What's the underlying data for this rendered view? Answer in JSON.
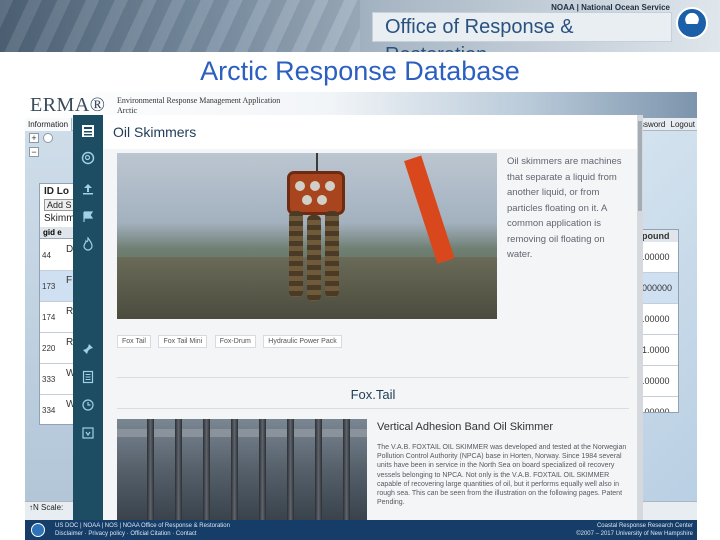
{
  "banner": {
    "noaa_line": "NOAA | National Ocean Service",
    "org_name": "Office of Response & Restoration",
    "logo_icon": "noaa-logo"
  },
  "slide_title": "Arctic Response Database",
  "erma": {
    "logo": "ERMA®",
    "subtitle_line1": "Environmental Response Management Application",
    "subtitle_line2": "Arctic",
    "menu_tab": "Information",
    "menu_right": [
      "ssword",
      "Logout"
    ],
    "menu_right_second": "d",
    "map_controls": [
      "+",
      "−"
    ],
    "grid": {
      "title": "ID Lo",
      "add_button": "Add S",
      "caption": "Skimm",
      "header": "gid  e",
      "rows": [
        {
          "gid": "44",
          "letter": "D"
        },
        {
          "gid": "173",
          "letter": "F"
        },
        {
          "gid": "174",
          "letter": "R"
        },
        {
          "gid": "220",
          "letter": "R"
        },
        {
          "gid": "333",
          "letter": "W"
        },
        {
          "gid": "334",
          "letter": "W"
        }
      ]
    },
    "right_grid": {
      "header": "pound",
      "values": [
        ".00000",
        "000000",
        ".00000",
        "1.0000",
        ".00000",
        ".00000"
      ]
    },
    "scale_label": "Scale:",
    "north_label": "↑N"
  },
  "nav_icons": [
    "table-icon",
    "search-icon",
    "upload-icon",
    "flag-icon",
    "fire-icon",
    "pin-icon",
    "file-icon",
    "history-icon",
    "download-icon"
  ],
  "panel": {
    "title": "Oil Skimmers",
    "description": "Oil skimmers are machines that separate a liquid from another liquid, or from particles floating on it. A common application is removing oil floating on water.",
    "chips": [
      "Fox Tail",
      "Fox Tail Mini",
      "Fox-Drum",
      "Hydraulic Power Pack"
    ],
    "section_title": "Fox.Tail",
    "sub_title": "Vertical Adhesion Band Oil Skimmer",
    "body": "The V.A.B. FOXTAIL OIL SKIMMER was developed and tested at the Norwegian Pollution Control Authority (NPCA) base in Horten, Norway. Since 1984 several units have been in service in the North Sea on board specialized oil recovery vessels belonging to NPCA. Not only is the V.A.B. FOXTAIL OIL SKIMMER capable of recovering large quantities of oil, but it performs equally well also in rough sea. This can be seen from the illustration on the following pages. Patent Pending."
  },
  "footer": {
    "left_line1": "US DOC | NOAA | NOS | NOAA Office of Response & Restoration",
    "left_line2": "Disclaimer · Privacy policy · Official Citation · Contact",
    "right_line1": "Coastal Response Research Center",
    "right_line2": "©2007 – 2017 University of New Hampshire"
  }
}
